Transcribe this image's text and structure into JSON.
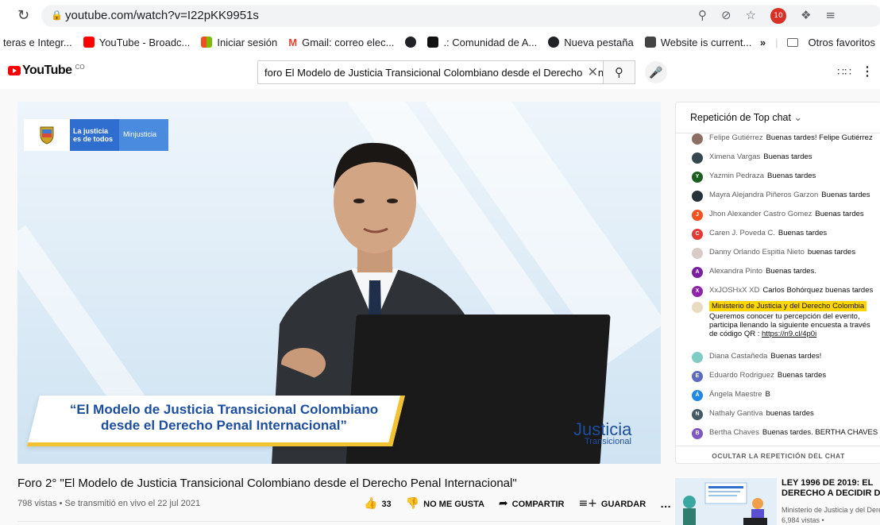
{
  "browser": {
    "url": "youtube.com/watch?v=I22pKK9951s",
    "extension_badge": "10",
    "bookmarks": [
      {
        "label": "teras e Integr...",
        "color": ""
      },
      {
        "label": "YouTube - Broadc...",
        "color": "#ff0000"
      },
      {
        "label": "Iniciar sesión",
        "color": "#f25022"
      },
      {
        "label": "Gmail: correo elec...",
        "color": "#ea4335"
      },
      {
        "label": "",
        "color": "#202124"
      },
      {
        "label": ".: Comunidad de A...",
        "color": "#111111"
      },
      {
        "label": "Nueva pestaña",
        "color": "#202124"
      },
      {
        "label": "Website is current...",
        "color": "#444444"
      }
    ],
    "more_bookmarks": "»",
    "other_favorites": "Otros favoritos"
  },
  "youtube": {
    "logo_text": "YouTube",
    "country_code": "CO",
    "search_value": "foro El Modelo de Justicia Transicional Colombiano desde el Derecho Penal"
  },
  "video": {
    "logo_line1": "La justicia",
    "logo_line2": "es de todos",
    "logo_ministry": "Minjusticia",
    "banner_line1": "“El Modelo de Justicia Transicional Colombiano",
    "banner_line2": "desde el Derecho Penal Internacional”",
    "brand_logo": "Justicia",
    "brand_logo_sub": "Transicional",
    "title": "Foro 2° \"El Modelo de Justicia Transicional Colombiano desde el Derecho Penal Internacional\"",
    "meta": "798 vistas • Se transmitió en vivo el 22 jul 2021",
    "likes": "33",
    "dislike_label": "NO ME GUSTA",
    "share_label": "COMPARTIR",
    "save_label": "GUARDAR"
  },
  "chat": {
    "header": "Repetición de Top chat",
    "messages": [
      {
        "author": "Felipe Gutiérrez",
        "text": "Buenas tardes! Felipe Gutiérrez",
        "color": "#8d6e63",
        "initial": ""
      },
      {
        "author": "Ximena Vargas",
        "text": "Buenas tardes",
        "color": "#37474f",
        "initial": ""
      },
      {
        "author": "Yazmin Pedraza",
        "text": "Buenas tardes",
        "color": "#1b5e20",
        "initial": "Y"
      },
      {
        "author": "Mayra Alejandra Piñeros Garzon",
        "text": "Buenas tardes",
        "color": "#263238",
        "initial": ""
      },
      {
        "author": "Jhon Alexander Castro Gomez",
        "text": "Buenas tardes",
        "color": "#f4511e",
        "initial": "J"
      },
      {
        "author": "Caren J. Poveda C.",
        "text": "Buenas tardes",
        "color": "#e53935",
        "initial": "C"
      },
      {
        "author": "Danny Orlando Espitia Nieto",
        "text": "buenas tardes",
        "color": "#d7ccc8",
        "initial": ""
      },
      {
        "author": "Alexandra Pinto",
        "text": "Buenas tardes.",
        "color": "#7b1fa2",
        "initial": "A"
      },
      {
        "author": "XxJOSHxX XD",
        "text": "Carlos Bohórquez buenas tardes",
        "color": "#8e24aa",
        "initial": "X"
      },
      {
        "author": "Diana Castañeda",
        "text": "Buenas tardes!",
        "color": "#80cbc4",
        "initial": ""
      },
      {
        "author": "Eduardo Rodriguez",
        "text": "Buenas tardes",
        "color": "#5c6bc0",
        "initial": "E"
      },
      {
        "author": "Ángela Maestre",
        "text": "B",
        "color": "#1e88e5",
        "initial": "Á"
      },
      {
        "author": "Nathaly Gantiva",
        "text": "buenas tardes",
        "color": "#455a64",
        "initial": "N"
      },
      {
        "author": "Bertha Chaves",
        "text": "Buenas tardes. BERTHA CHAVES",
        "color": "#7e57c2",
        "initial": "B"
      }
    ],
    "pinned": {
      "author": "Ministerio de Justicia y del Derecho Colombia",
      "text": "Queremos conocer tu percepción del evento, participa llenando la siguiente encuesta a través de código QR : ",
      "link": "https://n9.cl/4p0i"
    },
    "hide_label": "OCULTAR LA REPETICIÓN DEL CHAT"
  },
  "recommendation": {
    "title_line1": "LEY 1996 DE 2019: EL",
    "title_line2": "DERECHO A DECIDIR DE LA",
    "channel": "Ministerio de Justicia y del Dere",
    "views": "6,984 vistas •"
  }
}
